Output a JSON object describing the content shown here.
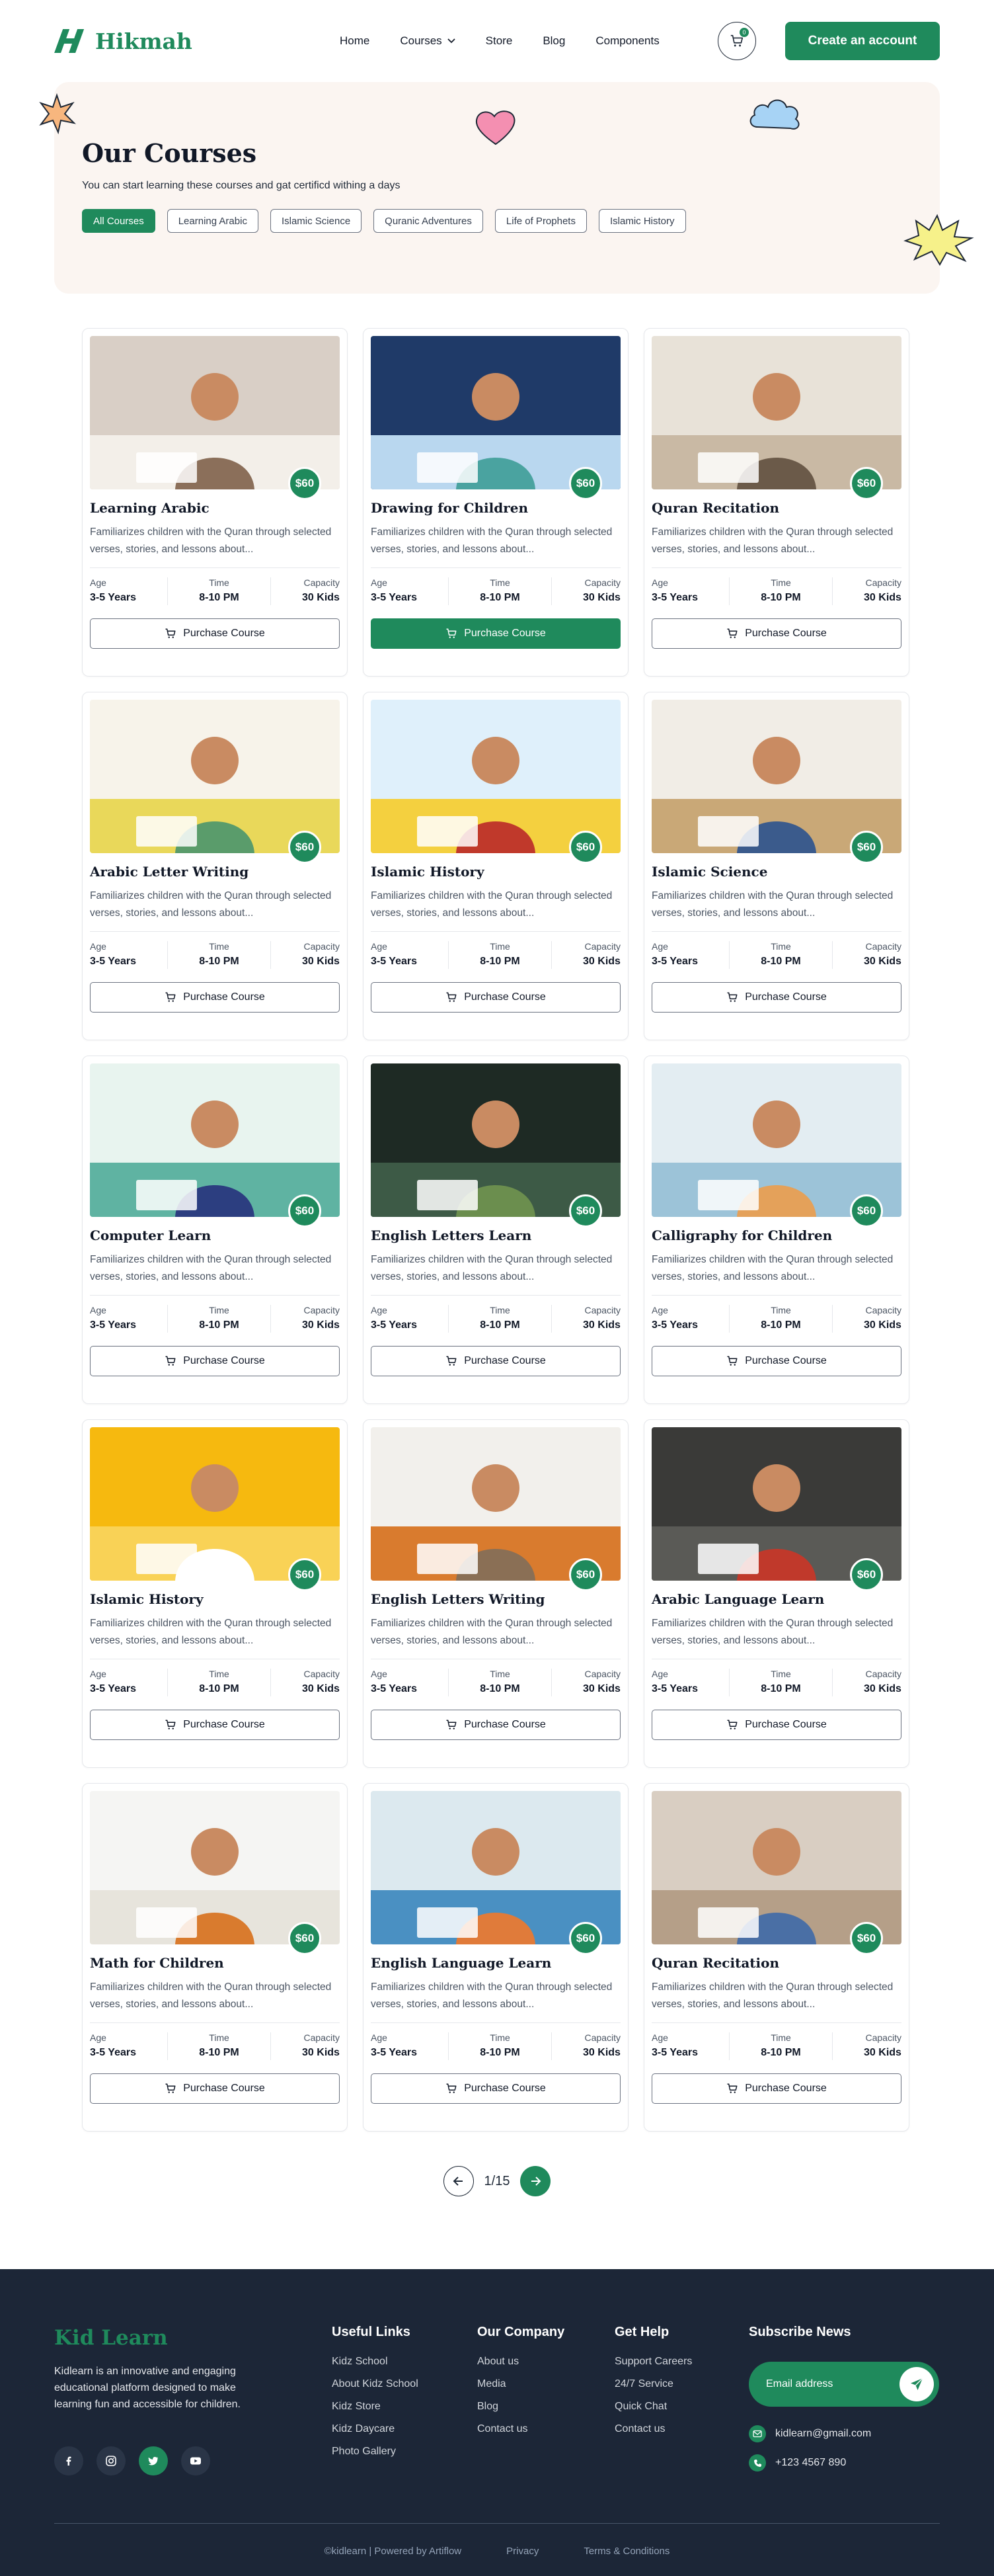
{
  "header": {
    "brand": "Hikmah",
    "nav": [
      {
        "label": "Home"
      },
      {
        "label": "Courses"
      },
      {
        "label": "Store"
      },
      {
        "label": "Blog"
      },
      {
        "label": "Components"
      }
    ],
    "cart_count": "0",
    "cta_label": "Create an account"
  },
  "hero": {
    "title": "Our Courses",
    "subtitle": "You can start learning  these courses and gat certificd withing a days",
    "filters": [
      "All Courses",
      "Learning Arabic",
      "Islamic Science",
      "Quranic Adventures",
      "Life of Prophets",
      "Islamic History"
    ],
    "active_filter": 0
  },
  "card_labels": {
    "age": "Age",
    "time": "Time",
    "capacity": "Capacity",
    "button": "Purchase Course"
  },
  "courses": [
    {
      "title": "Learning Arabic",
      "price": "$60",
      "desc": "Familiarizes children with the Quran through selected verses, stories, and lessons about...",
      "age": "3-5 Years",
      "time": "8-10 PM",
      "capacity": "30 Kids",
      "highlight": false
    },
    {
      "title": "Drawing for Children",
      "price": "$60",
      "desc": "Familiarizes children with the Quran through selected verses, stories, and lessons about...",
      "age": "3-5 Years",
      "time": "8-10 PM",
      "capacity": "30 Kids",
      "highlight": true
    },
    {
      "title": "Quran Recitation",
      "price": "$60",
      "desc": "Familiarizes children with the Quran through selected verses, stories, and lessons about...",
      "age": "3-5 Years",
      "time": "8-10 PM",
      "capacity": "30 Kids",
      "highlight": false
    },
    {
      "title": "Arabic Letter Writing",
      "price": "$60",
      "desc": "Familiarizes children with the Quran through selected verses, stories, and lessons about...",
      "age": "3-5 Years",
      "time": "8-10 PM",
      "capacity": "30 Kids",
      "highlight": false
    },
    {
      "title": "Islamic History",
      "price": "$60",
      "desc": "Familiarizes children with the Quran through selected verses, stories, and lessons about...",
      "age": "3-5 Years",
      "time": "8-10 PM",
      "capacity": "30 Kids",
      "highlight": false
    },
    {
      "title": "Islamic Science",
      "price": "$60",
      "desc": "Familiarizes children with the Quran through selected verses, stories, and lessons about...",
      "age": "3-5 Years",
      "time": "8-10 PM",
      "capacity": "30 Kids",
      "highlight": false
    },
    {
      "title": "Computer Learn",
      "price": "$60",
      "desc": "Familiarizes children with the Quran through selected verses, stories, and lessons about...",
      "age": "3-5 Years",
      "time": "8-10 PM",
      "capacity": "30 Kids",
      "highlight": false
    },
    {
      "title": "English Letters Learn",
      "price": "$60",
      "desc": "Familiarizes children with the Quran through selected verses, stories, and lessons about...",
      "age": "3-5 Years",
      "time": "8-10 PM",
      "capacity": "30 Kids",
      "highlight": false
    },
    {
      "title": "Calligraphy for Children",
      "price": "$60",
      "desc": "Familiarizes children with the Quran through selected verses, stories, and lessons about...",
      "age": "3-5 Years",
      "time": "8-10 PM",
      "capacity": "30 Kids",
      "highlight": false
    },
    {
      "title": "Islamic History",
      "price": "$60",
      "desc": "Familiarizes children with the Quran through selected verses, stories, and lessons about...",
      "age": "3-5 Years",
      "time": "8-10 PM",
      "capacity": "30 Kids",
      "highlight": false
    },
    {
      "title": "English Letters Writing",
      "price": "$60",
      "desc": "Familiarizes children with the Quran through selected verses, stories, and lessons about...",
      "age": "3-5 Years",
      "time": "8-10 PM",
      "capacity": "30 Kids",
      "highlight": false
    },
    {
      "title": "Arabic Language Learn",
      "price": "$60",
      "desc": "Familiarizes children with the Quran through selected verses, stories, and lessons about...",
      "age": "3-5 Years",
      "time": "8-10 PM",
      "capacity": "30 Kids",
      "highlight": false
    },
    {
      "title": "Math for Children",
      "price": "$60",
      "desc": "Familiarizes children with the Quran through selected verses, stories, and lessons about...",
      "age": "3-5 Years",
      "time": "8-10 PM",
      "capacity": "30 Kids",
      "highlight": false
    },
    {
      "title": "English Language Learn",
      "price": "$60",
      "desc": "Familiarizes children with the Quran through selected verses, stories, and lessons about...",
      "age": "3-5 Years",
      "time": "8-10 PM",
      "capacity": "30 Kids",
      "highlight": false
    },
    {
      "title": "Quran Recitation",
      "price": "$60",
      "desc": "Familiarizes children with the Quran through selected verses, stories, and lessons about...",
      "age": "3-5 Years",
      "time": "8-10 PM",
      "capacity": "30 Kids",
      "highlight": false
    }
  ],
  "pagination": {
    "text": "1/15"
  },
  "footer": {
    "brand": "Kid Learn",
    "about": "Kidlearn is an innovative and engaging educational platform designed to make learning fun and accessible for children.",
    "columns": [
      {
        "title": "Useful Links",
        "links": [
          "Kidz School",
          "About Kidz School",
          "Kidz Store",
          "Kidz Daycare",
          "Photo Gallery"
        ]
      },
      {
        "title": "Our Company",
        "links": [
          "About us",
          "Media",
          "Blog",
          "Contact us"
        ]
      },
      {
        "title": "Get Help",
        "links": [
          "Support Careers",
          "24/7 Service",
          "Quick Chat",
          "Contact us"
        ]
      }
    ],
    "subscribe_title": "Subscribe News",
    "email_placeholder": "Email address",
    "email": "kidlearn@gmail.com",
    "phone": "+123 4567 890",
    "copyright": "©kidlearn | Powered by Artiflow",
    "privacy": "Privacy",
    "terms": "Terms & Conditions"
  },
  "colors": {
    "accent": "#1f8a5c",
    "footer_bg": "#1c2637",
    "hero_bg": "#fbf5f1"
  }
}
